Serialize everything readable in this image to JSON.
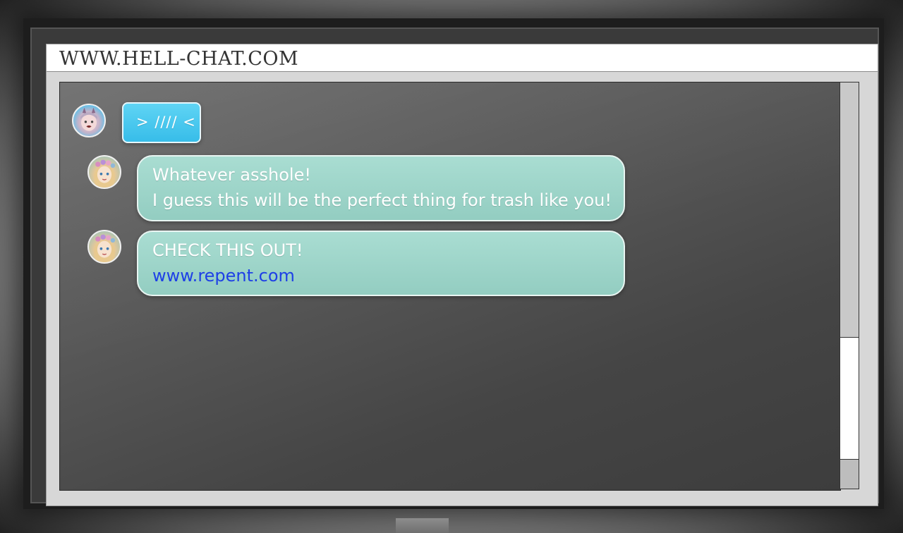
{
  "browser": {
    "address": "WWW.HELL-CHAT.COM"
  },
  "messages": [
    {
      "sender": "demon",
      "avatar_icon": "demon-avatar-icon",
      "lines": [
        "> //// <"
      ],
      "is_link": false
    },
    {
      "sender": "elf",
      "avatar_icon": "elf-avatar-icon",
      "lines": [
        "Whatever asshole!",
        "I guess this will be the perfect thing for trash like you!"
      ],
      "is_link": false
    },
    {
      "sender": "elf",
      "avatar_icon": "elf-avatar-icon",
      "lines": [
        "CHECK THIS OUT!"
      ],
      "link": "www.repent.com"
    }
  ],
  "colors": {
    "bubble_teal": "#9fd6cb",
    "bubble_blue": "#42c4ee",
    "link": "#1e40e6",
    "chat_background": "#5a5a5a"
  }
}
